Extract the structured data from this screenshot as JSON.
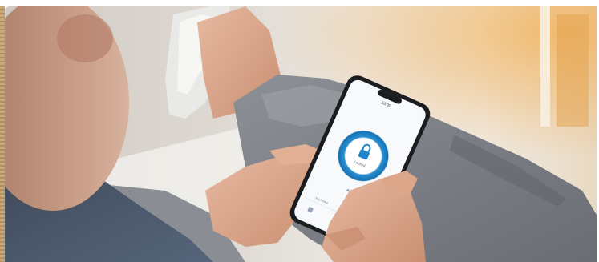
{
  "photo": {
    "subject": "person holding smartphone",
    "accent_color": "#1e86c8",
    "icon": "lock-icon"
  },
  "phone_screen": {
    "time": "16:30",
    "status_text": "Locked",
    "footer_text": "My Home"
  }
}
